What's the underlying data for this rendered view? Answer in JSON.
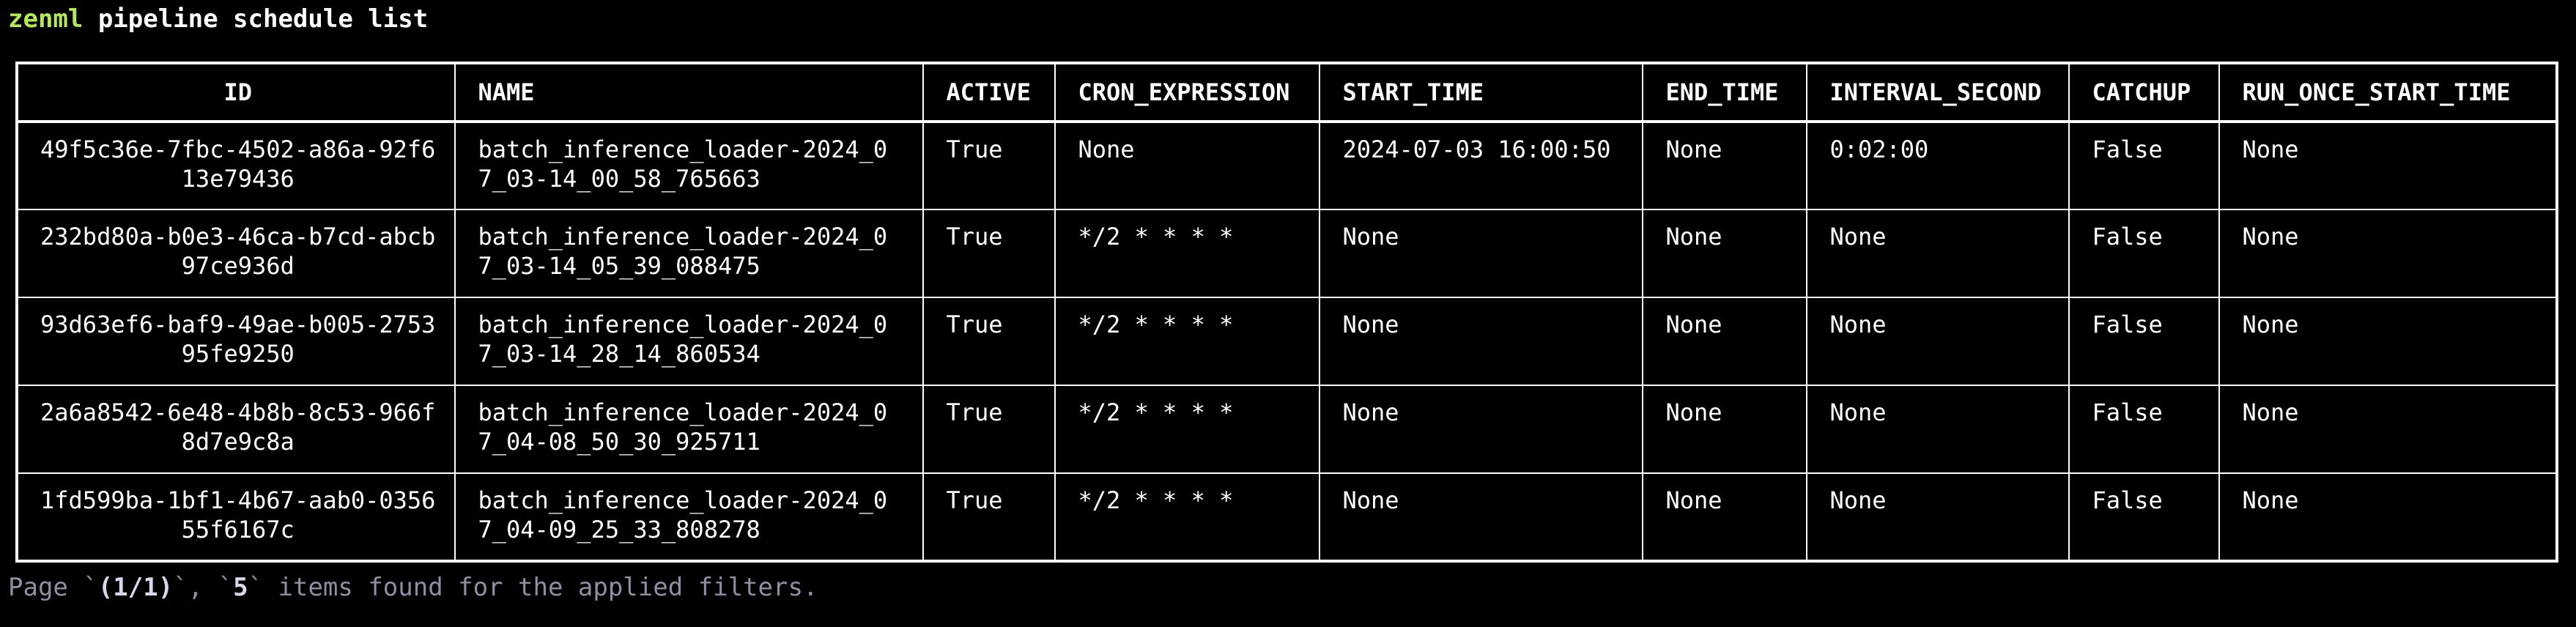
{
  "terminal": {
    "command_program": "zenml",
    "command_args": " pipeline schedule list"
  },
  "table": {
    "headers": [
      "ID",
      "NAME",
      "ACTIVE",
      "CRON_EXPRESSION",
      "START_TIME",
      "END_TIME",
      "INTERVAL_SECOND",
      "CATCHUP",
      "RUN_ONCE_START_TIME"
    ],
    "rows": [
      {
        "id_line1": "49f5c36e-7fbc-4502-a86a-92f6",
        "id_line2": "13e79436",
        "name_line1": "batch_inference_loader-2024_0",
        "name_line2": "7_03-14_00_58_765663",
        "active": "True",
        "cron_expression": "None",
        "start_time": "2024-07-03 16:00:50",
        "end_time": "None",
        "interval_second": "0:02:00",
        "catchup": "False",
        "run_once_start_time": "None"
      },
      {
        "id_line1": "232bd80a-b0e3-46ca-b7cd-abcb",
        "id_line2": "97ce936d",
        "name_line1": "batch_inference_loader-2024_0",
        "name_line2": "7_03-14_05_39_088475",
        "active": "True",
        "cron_expression": "*/2 * * * *",
        "start_time": "None",
        "end_time": "None",
        "interval_second": "None",
        "catchup": "False",
        "run_once_start_time": "None"
      },
      {
        "id_line1": "93d63ef6-baf9-49ae-b005-2753",
        "id_line2": "95fe9250",
        "name_line1": "batch_inference_loader-2024_0",
        "name_line2": "7_03-14_28_14_860534",
        "active": "True",
        "cron_expression": "*/2 * * * *",
        "start_time": "None",
        "end_time": "None",
        "interval_second": "None",
        "catchup": "False",
        "run_once_start_time": "None"
      },
      {
        "id_line1": "2a6a8542-6e48-4b8b-8c53-966f",
        "id_line2": "8d7e9c8a",
        "name_line1": "batch_inference_loader-2024_0",
        "name_line2": "7_04-08_50_30_925711",
        "active": "True",
        "cron_expression": "*/2 * * * *",
        "start_time": "None",
        "end_time": "None",
        "interval_second": "None",
        "catchup": "False",
        "run_once_start_time": "None"
      },
      {
        "id_line1": "1fd599ba-1bf1-4b67-aab0-0356",
        "id_line2": "55f6167c",
        "name_line1": "batch_inference_loader-2024_0",
        "name_line2": "7_04-09_25_33_808278",
        "active": "True",
        "cron_expression": "*/2 * * * *",
        "start_time": "None",
        "end_time": "None",
        "interval_second": "None",
        "catchup": "False",
        "run_once_start_time": "None"
      }
    ]
  },
  "footer": {
    "prefix": "Page `",
    "page": "(1/1)",
    "middle": "`, `",
    "count": "5",
    "suffix": "` items found for the applied filters."
  }
}
